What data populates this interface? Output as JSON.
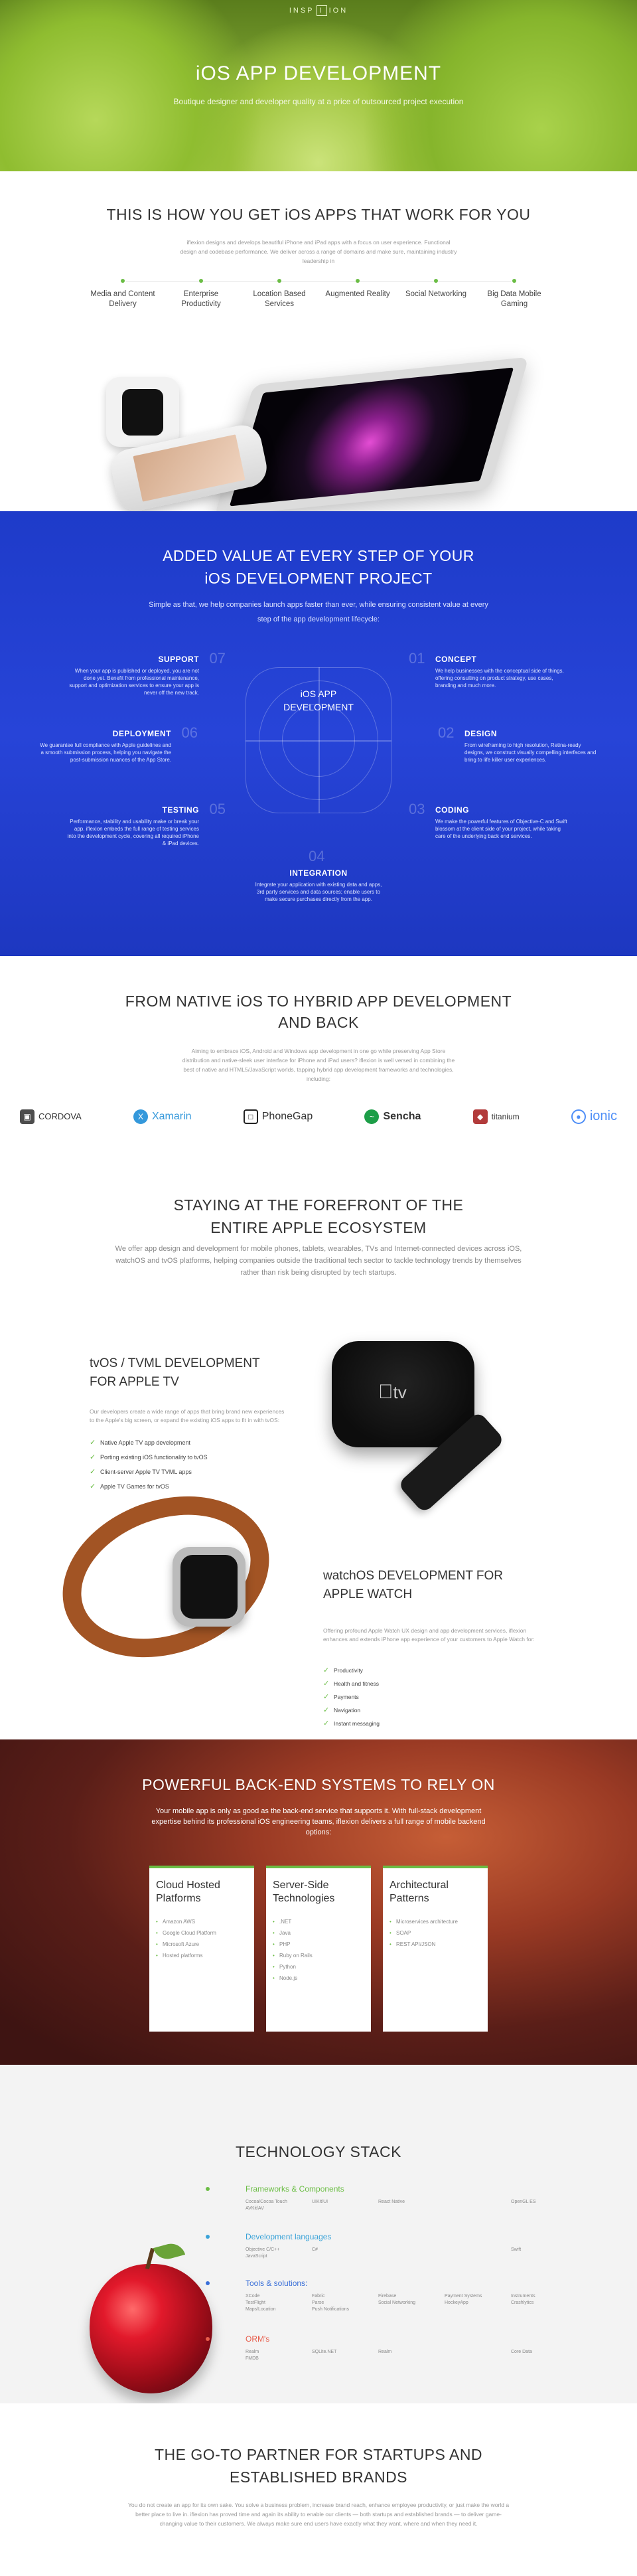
{
  "brand": {
    "left": "INSP",
    "mark": "I",
    "right": "ION"
  },
  "hero": {
    "title": "iOS APP DEVELOPMENT",
    "subtitle": "Boutique designer and developer quality at a price of outsourced project execution"
  },
  "intro": {
    "title": "THIS IS HOW YOU GET iOS APPS THAT WORK FOR YOU",
    "text": "iflexion designs and develops beautiful iPhone and iPad apps with a focus on user experience. Functional design and codebase performance. We deliver across a range of domains and make sure, maintaining industry leadership in",
    "features": [
      "Media and Content Delivery",
      "Enterprise Productivity",
      "Location Based Services",
      "Augmented Reality",
      "Social Networking",
      "Big Data Mobile Gaming"
    ]
  },
  "process": {
    "title_line1": "ADDED VALUE AT EVERY STEP OF YOUR",
    "title_line2": "iOS DEVELOPMENT PROJECT",
    "text": "Simple as that, we help companies launch apps faster than ever, while ensuring consistent value at every step of the app development lifecycle:",
    "center_line1": "iOS APP",
    "center_line2": "DEVELOPMENT",
    "steps": [
      {
        "n": "01",
        "title": "CONCEPT",
        "text": "We help businesses with the conceptual side of things, offering consulting on product strategy, use cases, branding and much more."
      },
      {
        "n": "02",
        "title": "DESIGN",
        "text": "From wireframing to high resolution, Retina-ready designs, we construct visually compelling interfaces and bring to life killer user experiences."
      },
      {
        "n": "03",
        "title": "CODING",
        "text": "We make the powerful features of Objective-C and Swift blossom at the client side of your project, while taking care of the underlying back end services."
      },
      {
        "n": "04",
        "title": "INTEGRATION",
        "text": "Integrate your application with existing data and apps, 3rd party services and data sources; enable users to make secure purchases directly from the app."
      },
      {
        "n": "05",
        "title": "TESTING",
        "text": "Performance, stability and usability make or break your app. iflexion embeds the full range of testing services into the development cycle, covering all required iPhone & iPad devices."
      },
      {
        "n": "06",
        "title": "DEPLOYMENT",
        "text": "We guarantee full compliance with Apple guidelines and a smooth submission process, helping you navigate the post-submission nuances of the App Store."
      },
      {
        "n": "07",
        "title": "SUPPORT",
        "text": "When your app is published or deployed, you are not done yet. Benefit from professional maintenance, support and optimization services to ensure your app is never off the new track."
      }
    ]
  },
  "hybrid": {
    "title": "FROM NATIVE iOS TO HYBRID APP DEVELOPMENT AND BACK",
    "text": "Aiming to embrace iOS, Android and Windows app development in one go while preserving App Store distribution and native-sleek user interface for iPhone and iPad users? iflexion is well versed in combining the best of native and HTML5/JavaScript worlds, tapping hybrid app development frameworks and technologies, including:",
    "logos": [
      {
        "name": "CORDOVA",
        "icon": "cordova-icon",
        "color": "#4d4d4d"
      },
      {
        "name": "Xamarin",
        "icon": "xamarin-icon",
        "color": "#3498db"
      },
      {
        "name": "PhoneGap",
        "icon": "phonegap-icon",
        "color": "#222222"
      },
      {
        "name": "Sencha",
        "icon": "sencha-icon",
        "color": "#1d9e48"
      },
      {
        "name": "titanium",
        "icon": "titanium-icon",
        "color": "#b23b3b"
      },
      {
        "name": "ionic",
        "icon": "ionic-icon",
        "color": "#4e8ef7"
      }
    ]
  },
  "ecosystem": {
    "title_line1": "STAYING AT THE FOREFRONT OF THE",
    "title_line2": "ENTIRE APPLE ECOSYSTEM",
    "text": "We offer app design and development for mobile phones, tablets, wearables, TVs and Internet-connected devices across iOS, watchOS and tvOS platforms, helping companies outside the traditional tech sector to tackle technology trends by themselves rather than risk being disrupted by tech startups.",
    "tv": {
      "title_line1": "tvOS / TVML DEVELOPMENT",
      "title_line2": "FOR APPLE TV",
      "text": "Our developers create a wide range of apps that bring brand new experiences to the Apple's big screen, or expand the existing iOS apps to fit in with tvOS:",
      "items": [
        "Native Apple TV app development",
        "Porting existing iOS functionality to tvOS",
        "Client-server Apple TV TVML apps",
        "Apple TV Games for tvOS"
      ],
      "device_label": "tv"
    },
    "watch": {
      "title_line1": "watchOS DEVELOPMENT FOR",
      "title_line2": "APPLE WATCH",
      "text": "Offering profound Apple Watch UX design and app development services, iflexion enhances and extends iPhone app experience of your customers to Apple Watch for:",
      "items": [
        "Productivity",
        "Health and fitness",
        "Payments",
        "Navigation",
        "Instant messaging"
      ]
    }
  },
  "backend": {
    "title": "POWERFUL BACK-END SYSTEMS TO RELY ON",
    "text": "Your mobile app is only as good as the back-end service that supports it. With full-stack development expertise behind its professional iOS engineering teams, iflexion delivers a full range of mobile backend options:",
    "cards": [
      {
        "title": "Cloud Hosted Platforms",
        "items": [
          "Amazon AWS",
          "Google Cloud Platform",
          "Microsoft Azure",
          "Hosted platforms"
        ]
      },
      {
        "title": "Server-Side Technologies",
        "items": [
          ".NET",
          "Java",
          "PHP",
          "Ruby on Rails",
          "Python",
          "Node.js"
        ]
      },
      {
        "title": "Architectural Patterns",
        "items": [
          "Microservices architecture",
          "SOAP",
          "REST API/JSON"
        ]
      }
    ]
  },
  "stack": {
    "title": "TECHNOLOGY STACK",
    "categories": [
      {
        "title": "Frameworks & Components",
        "color": "#6bbd45",
        "items": [
          "Cocoa/Cocoa Touch",
          "OpenGL ES",
          "UIKit/UI",
          "AVKit/AV",
          "React Native"
        ]
      },
      {
        "title": "Development languages",
        "color": "#3aa3d8",
        "items": [
          "Objective C/C++",
          "Swift",
          "C#",
          "JavaScript"
        ]
      },
      {
        "title": "Tools & solutions:",
        "color": "#3a6fd8",
        "items": [
          "XCode",
          "Instruments",
          "HockeyApp",
          "Fabric",
          "TestFlight",
          "Crashlytics",
          "Firebase",
          "Parse",
          "Payment Systems",
          "Social Networking",
          "Maps/Location",
          "Push Notifications"
        ]
      },
      {
        "title": "ORM's",
        "color": "#e85c4a",
        "items": [
          "Realm",
          "Core Data",
          "SQLite.NET",
          "FMDB",
          "Realm"
        ]
      }
    ]
  },
  "partner": {
    "title_line1": "THE GO-TO PARTNER FOR STARTUPS AND",
    "title_line2": "ESTABLISHED BRANDS",
    "text": "You do not create an app for its own sake. You solve a business problem, increase brand reach, enhance employee productivity, or just make the world a better place to live in. iflexion has proved time and again its ability to enable our clients — both startups and established brands — to deliver game-changing value to their customers. We always make sure end users have exactly what they want, where and when they need it."
  },
  "colors": {
    "green": "#6bbd45",
    "blue": "#2744d8"
  }
}
